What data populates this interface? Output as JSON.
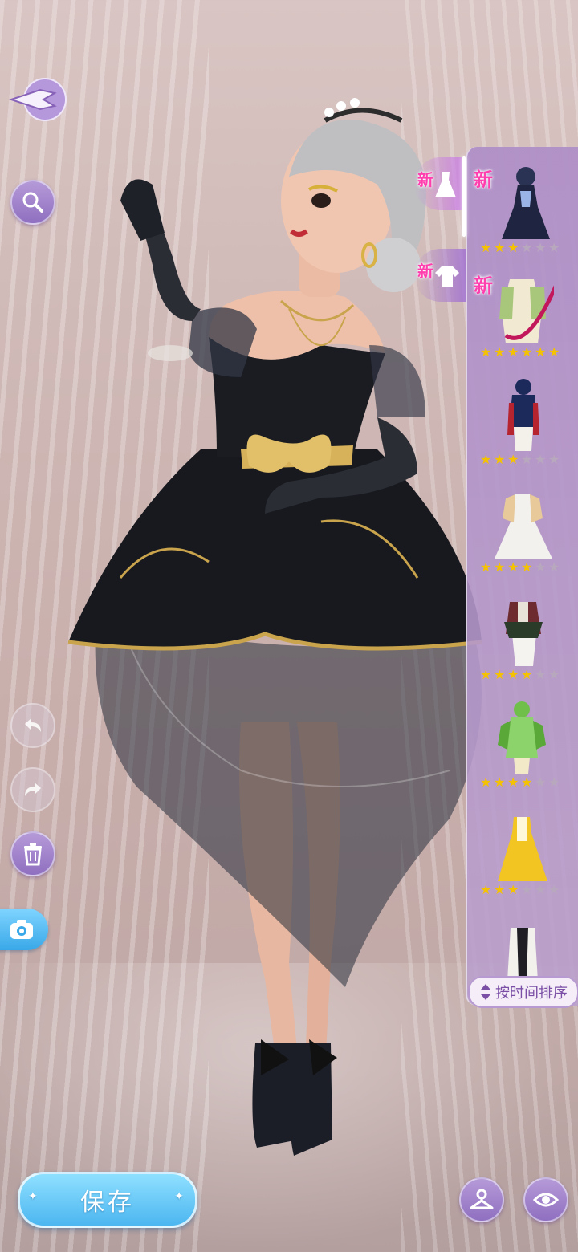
{
  "panel": {
    "tabs": [
      {
        "name": "dress-tab",
        "new_label": "新"
      },
      {
        "name": "top-tab",
        "new_label": "新"
      }
    ],
    "items": [
      {
        "new_label": "新",
        "stars": 3,
        "max_stars": 5,
        "icon": "dress-outfit-navy"
      },
      {
        "new_label": "新",
        "stars": 5,
        "max_stars": 5,
        "icon": "outfit-cream-green"
      },
      {
        "new_label": "",
        "stars": 2,
        "max_stars": 5,
        "icon": "outfit-red-navy"
      },
      {
        "new_label": "",
        "stars": 4,
        "max_stars": 5,
        "icon": "gown-white"
      },
      {
        "new_label": "",
        "stars": 4,
        "max_stars": 5,
        "icon": "outfit-burgundy"
      },
      {
        "new_label": "",
        "stars": 4,
        "max_stars": 5,
        "icon": "outfit-green"
      },
      {
        "new_label": "",
        "stars": 2,
        "max_stars": 5,
        "icon": "outfit-yellow"
      },
      {
        "new_label": "",
        "stars": 0,
        "max_stars": 5,
        "icon": "outfit-white-black"
      }
    ],
    "sort_label": "按时间排序"
  },
  "footer": {
    "save_label": "保存"
  },
  "icons": {
    "back": "back-arrow-icon",
    "search": "search-icon",
    "undo": "undo-icon",
    "redo": "redo-icon",
    "delete": "trash-icon",
    "camera": "camera-icon",
    "hanger": "hanger-icon",
    "eye": "eye-icon",
    "sort": "sort-arrows-icon"
  },
  "colors": {
    "accent_purple": "#9b7cc8",
    "save_blue": "#4cb6f0",
    "new_pink": "#ff3fae",
    "star_gold": "#f4c200"
  }
}
